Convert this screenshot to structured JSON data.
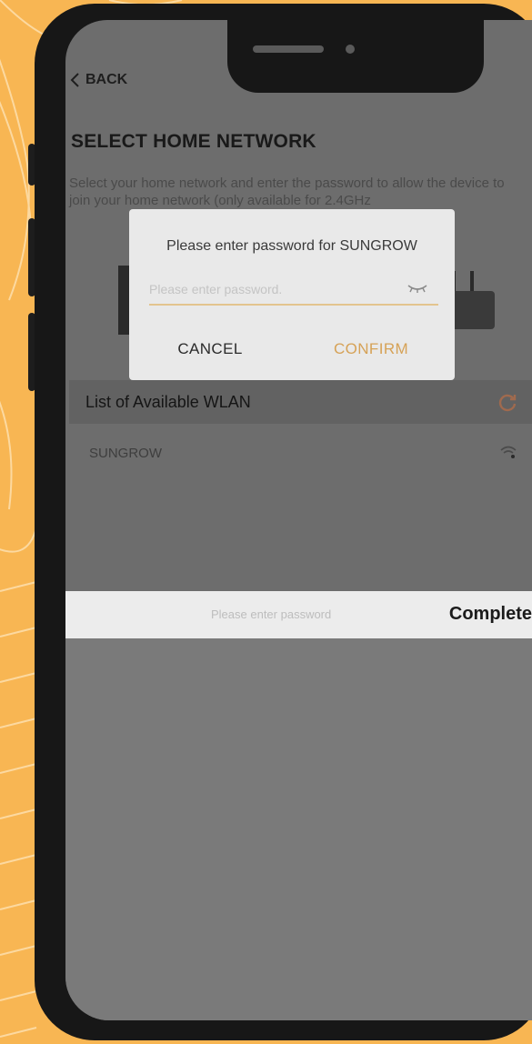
{
  "header": {
    "back_label": "BACK",
    "title": "SELECT HOME NETWORK",
    "description": "Select your home network and enter the password to allow the device to join your home network (only available for 2.4GHz"
  },
  "wlan": {
    "header_label": "List of Available WLAN",
    "items": [
      {
        "label": "SUNGROW"
      }
    ]
  },
  "dialog": {
    "title": "Please enter password for SUNGROW",
    "password_value": "",
    "password_placeholder": "Please enter password.",
    "cancel_label": "CANCEL",
    "confirm_label": "CONFIRM"
  },
  "keyboard_bar": {
    "placeholder_text": "Please enter password",
    "complete_label": "Complete"
  },
  "colors": {
    "background": "#f8b653",
    "accent": "#d6a257",
    "phone_frame": "#171717"
  },
  "icons": {
    "back": "chevron-left-icon",
    "eye": "eye-closed-icon",
    "refresh": "refresh-icon",
    "wifi": "wifi-icon"
  }
}
